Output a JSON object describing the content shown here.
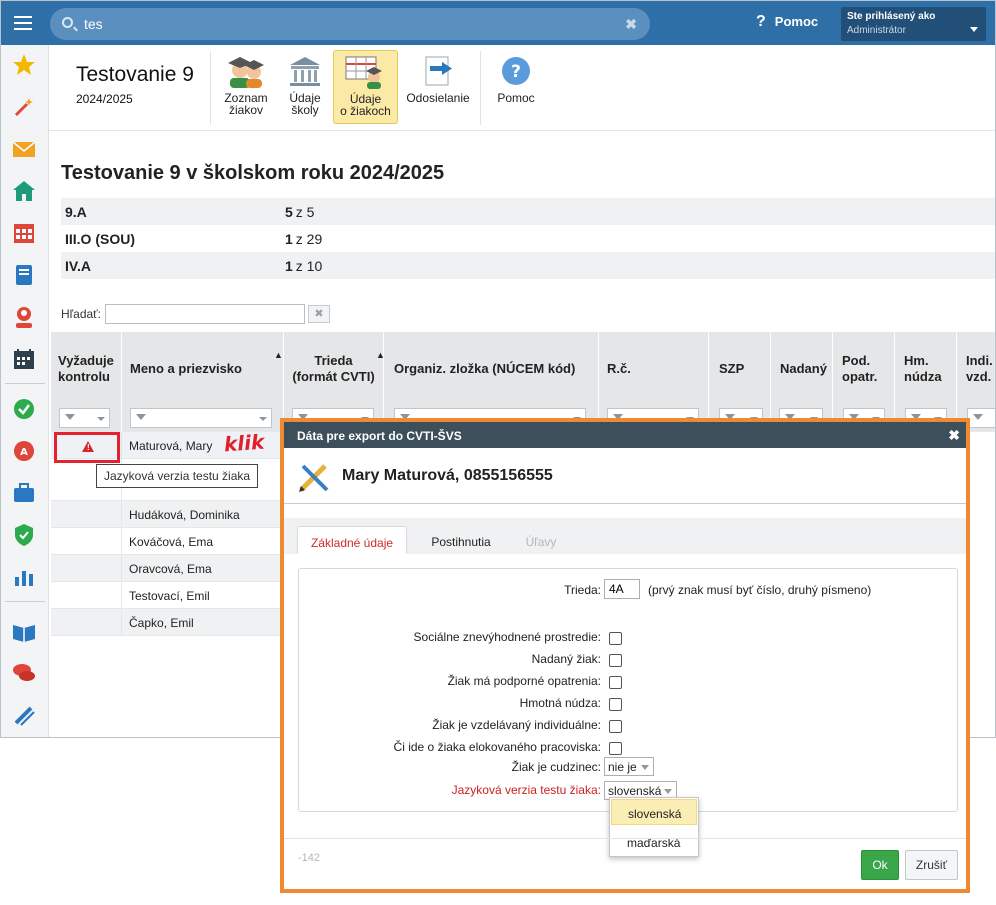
{
  "search": {
    "value": "tes"
  },
  "topbar": {
    "help": "Pomoc",
    "user_line1": "Ste prihlásený ako",
    "user_line2": "Administrátor"
  },
  "app": {
    "title": "Testovanie 9",
    "year": "2024/2025"
  },
  "toolbar": {
    "buttons": [
      {
        "label1": "Zoznam",
        "label2": "žiakov",
        "icon": "students-icon"
      },
      {
        "label1": "Údaje",
        "label2": "školy",
        "icon": "school-icon"
      },
      {
        "label1": "Údaje",
        "label2": "o žiakoch",
        "icon": "student-data-icon"
      },
      {
        "label1": "Odosielanie",
        "label2": "",
        "icon": "send-icon"
      },
      {
        "label1": "Pomoc",
        "label2": "",
        "icon": "help-icon"
      }
    ]
  },
  "content": {
    "title": "Testovanie 9 v školskom roku 2024/2025",
    "summary": [
      {
        "class": "9.A",
        "count": "5",
        "of": "z 5"
      },
      {
        "class": "III.O (SOU)",
        "count": "1",
        "of": "z 29"
      },
      {
        "class": "IV.A",
        "count": "1",
        "of": "z 10"
      }
    ],
    "filter_label": "Hľadať:"
  },
  "grid": {
    "headers": {
      "kontrola1": "Vyžaduje",
      "kontrola2": "kontrolu",
      "meno": "Meno a priezvisko",
      "trieda1": "Trieda",
      "trieda2": "(formát CVTI)",
      "zlozka": "Organiz. zložka (NÚCEM kód)",
      "rc": "R.č.",
      "szp": "SZP",
      "nadany": "Nadaný",
      "pod1": "Pod.",
      "pod2": "opatr.",
      "hm1": "Hm.",
      "hm2": "núdza",
      "ind1": "Indi.",
      "ind2": "vzd."
    },
    "rows": [
      "Maturová, Mary",
      "",
      "Hudáková, Dominika",
      "Kováčová, Ema",
      "Oravcová, Ema",
      "Testovací, Emil",
      "Čapko, Emil"
    ],
    "annotation": "klik",
    "tooltip": "Jazyková verzia testu žiaka"
  },
  "dialog": {
    "title": "Dáta pre export do CVTI-ŠVS",
    "student": "Mary Maturová, 0855156555",
    "tabs": [
      "Základné údaje",
      "Postihnutia",
      "Úľavy"
    ],
    "trieda_label": "Trieda:",
    "trieda_value": "4A",
    "trieda_hint": "(prvý znak musí byť číslo, druhý písmeno)",
    "checks": [
      "Sociálne znevýhodnené prostredie:",
      "Nadaný žiak:",
      "Žiak má podporné opatrenia:",
      "Hmotná núdza:",
      "Žiak je vzdelávaný individuálne:",
      "Či ide o žiaka elokovaného pracoviska:"
    ],
    "cudzinec_label": "Žiak je cudzinec:",
    "cudzinec_value": "nie je",
    "jazyk_label": "Jazyková verzia testu žiaka:",
    "jazyk_value": "slovenská",
    "jazyk_options": [
      "slovenská",
      "maďarská"
    ],
    "code": "-142",
    "ok": "Ok",
    "cancel": "Zrušiť"
  },
  "colors": {
    "topbar": "#2e6fa8",
    "accent_orange": "#f08a32",
    "ok_green": "#3aa64a",
    "warn_red": "#d9242c"
  }
}
